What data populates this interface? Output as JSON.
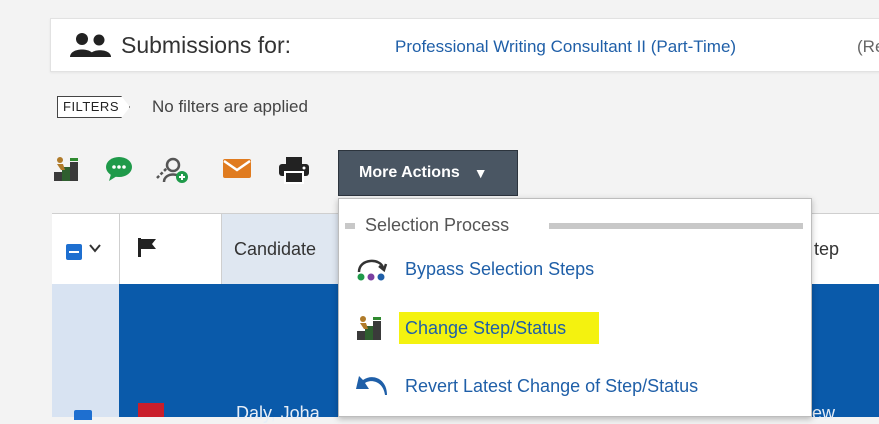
{
  "header": {
    "label": "Submissions for:",
    "requisition_title": "Professional Writing Consultant II (Part-Time)",
    "requisition_suffix": "(Requis"
  },
  "filters": {
    "tag": "FILTERS",
    "text": "No filters are applied"
  },
  "toolbar": {
    "icons": [
      "change-step-icon",
      "chat-bubble-icon",
      "add-user-icon",
      "mail-icon",
      "printer-icon"
    ],
    "more_actions_label": "More Actions",
    "more_actions_caret": "▼"
  },
  "table": {
    "columns": [
      "Candidate",
      "tep"
    ],
    "row": {
      "name": "Daly, Joha",
      "right_text": "ew"
    }
  },
  "dropdown": {
    "section_title": "Selection Process",
    "items": [
      {
        "label": "Bypass Selection Steps",
        "icon": "bypass-steps-icon",
        "highlighted": false
      },
      {
        "label": "Change Step/Status",
        "icon": "change-step-icon",
        "highlighted": true
      },
      {
        "label": "Revert Latest Change of Step/Status",
        "icon": "undo-arrow-icon",
        "highlighted": false
      }
    ]
  },
  "colors": {
    "accent_link": "#1f5fa8",
    "button_bg": "#4a5663",
    "selected_row": "#0a5aaa",
    "highlight": "#f4f20f",
    "checkbox": "#1e6fd0"
  }
}
